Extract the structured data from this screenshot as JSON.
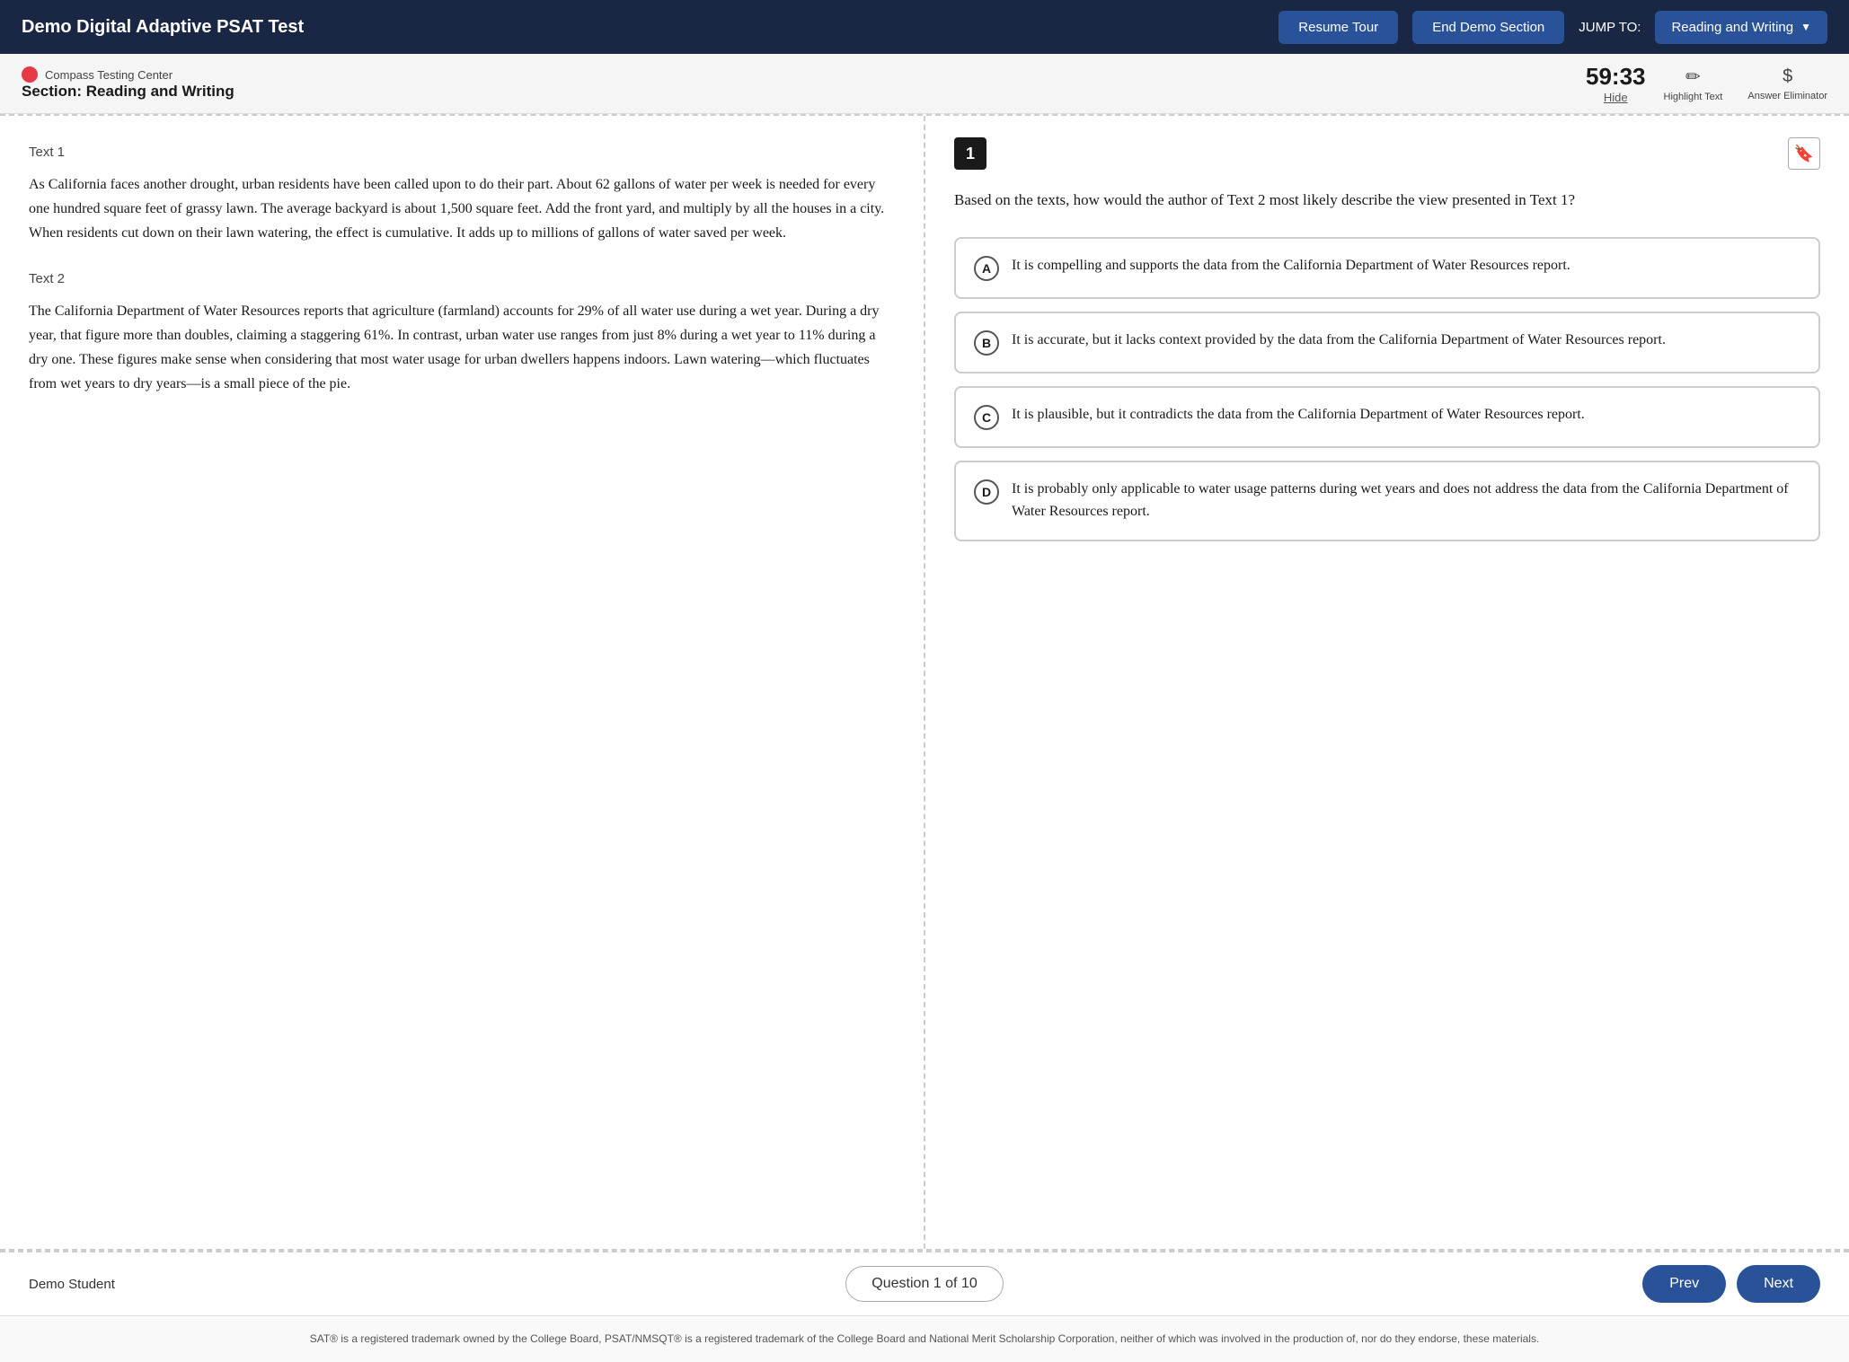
{
  "app": {
    "title": "Demo Digital Adaptive PSAT Test",
    "resume_tour": "Resume Tour",
    "end_demo": "End Demo Section",
    "jump_to_label": "JUMP TO:",
    "jump_to_value": "Reading and Writing"
  },
  "subheader": {
    "org_name": "Compass Testing Center",
    "section_label": "Section: Reading and Writing",
    "timer": "59:33",
    "hide_label": "Hide",
    "highlight_text": "Highlight Text",
    "answer_eliminator": "Answer Eliminator"
  },
  "passage": {
    "text1_label": "Text 1",
    "text1_body": "As California faces another drought, urban residents have been called upon to do their part. About 62 gallons of water per week is needed for every one hundred square feet of grassy lawn. The average backyard is about 1,500 square feet. Add the front yard, and multiply by all the houses in a city. When residents cut down on their lawn watering, the effect is cumulative. It adds up to millions of gallons of water saved per week.",
    "text2_label": "Text 2",
    "text2_body": "The California Department of Water Resources reports that agriculture (farmland) accounts for 29% of all water use during a wet year. During a dry year, that figure more than doubles, claiming a staggering 61%. In contrast, urban water use ranges from just 8% during a wet year to 11% during a dry one. These figures make sense when considering that most water usage for urban dwellers happens indoors. Lawn watering—which fluctuates from wet years to dry years—is a small piece of the pie."
  },
  "question": {
    "number": "1",
    "text": "Based on the texts, how would the author of Text 2 most likely describe the view presented in Text 1?",
    "choices": [
      {
        "letter": "A",
        "text": "It is compelling and supports the data from the California Department of Water Resources report."
      },
      {
        "letter": "B",
        "text": "It is accurate, but it lacks context provided by the data from the California Department of Water Resources report."
      },
      {
        "letter": "C",
        "text": "It is plausible, but it contradicts the data from the California Department of Water Resources report."
      },
      {
        "letter": "D",
        "text": "It is probably only applicable to water usage patterns during wet years and does not address the data from the California Department of Water Resources report."
      }
    ]
  },
  "bottom_bar": {
    "student_name": "Demo Student",
    "question_counter": "Question 1 of 10",
    "prev_label": "Prev",
    "next_label": "Next"
  },
  "footer": {
    "text": "SAT® is a registered trademark owned by the College Board, PSAT/NMSQT® is a registered trademark of the College Board and National Merit Scholarship Corporation, neither of which was involved in the production of, nor do they endorse, these materials."
  }
}
